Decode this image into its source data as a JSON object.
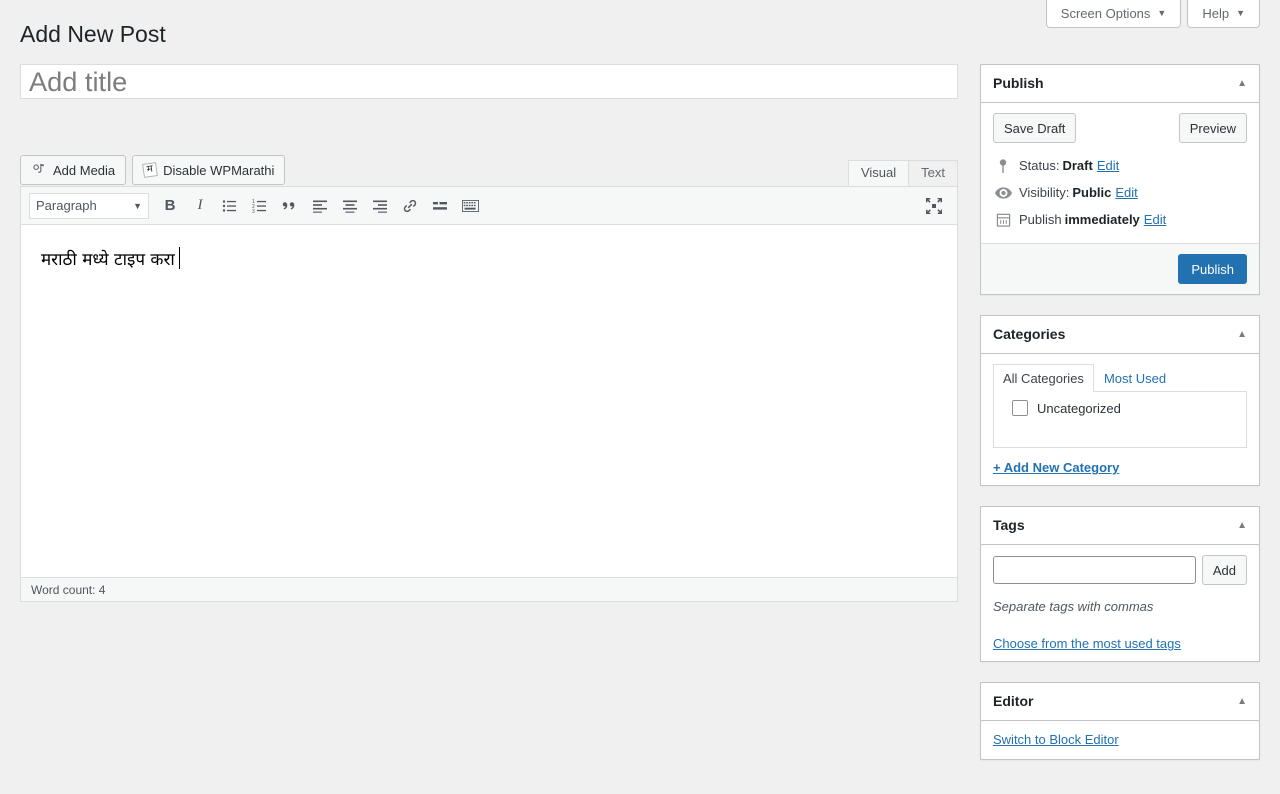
{
  "screen_meta": {
    "screen_options_label": "Screen Options",
    "help_label": "Help",
    "caret": "▼"
  },
  "page": {
    "title": "Add New Post"
  },
  "title_field": {
    "value": "",
    "placeholder": "Add title"
  },
  "media_buttons": {
    "add_media_label": "Add Media",
    "disable_wpmarathi_label": "Disable WPMarathi",
    "wpmarathi_glyph": "म"
  },
  "editor_tabs": {
    "visual_label": "Visual",
    "text_label": "Text",
    "active": "Visual"
  },
  "toolbar": {
    "format_label": "Paragraph",
    "format_caret": "▼",
    "buttons": [
      {
        "name": "bold-icon",
        "label": "B"
      },
      {
        "name": "italic-icon",
        "label": "I"
      },
      {
        "name": "bulleted-list-icon",
        "label": ""
      },
      {
        "name": "numbered-list-icon",
        "label": ""
      },
      {
        "name": "blockquote-icon",
        "label": "“"
      },
      {
        "name": "align-left-icon",
        "label": ""
      },
      {
        "name": "align-center-icon",
        "label": ""
      },
      {
        "name": "align-right-icon",
        "label": ""
      },
      {
        "name": "link-icon",
        "label": ""
      },
      {
        "name": "read-more-icon",
        "label": ""
      },
      {
        "name": "toolbar-toggle-icon",
        "label": ""
      }
    ],
    "fullscreen_name": "distraction-free-icon"
  },
  "editor": {
    "content": "मराठी मध्ये टाइप करा",
    "word_count": "Word count: 4"
  },
  "publish_box": {
    "title": "Publish",
    "toggle_arrow": "▲",
    "save_draft_label": "Save Draft",
    "preview_label": "Preview",
    "status_prefix": "Status:",
    "status_value": "Draft",
    "status_edit": "Edit",
    "visibility_prefix": "Visibility:",
    "visibility_value": "Public",
    "visibility_edit": "Edit",
    "publish_prefix": "Publish",
    "publish_value": "immediately",
    "publish_edit": "Edit",
    "publish_button_label": "Publish"
  },
  "categories_box": {
    "title": "Categories",
    "toggle_arrow": "▲",
    "tab_all_label": "All Categories",
    "tab_most_used_label": "Most Used",
    "active_tab": "All Categories",
    "items": [
      {
        "label": "Uncategorized",
        "checked": false
      }
    ],
    "add_new_label": "+ Add New Category"
  },
  "tags_box": {
    "title": "Tags",
    "toggle_arrow": "▲",
    "input_value": "",
    "input_placeholder": "",
    "add_label": "Add",
    "hint": "Separate tags with commas",
    "most_used_link": "Choose from the most used tags"
  },
  "editor_box": {
    "title": "Editor",
    "toggle_arrow": "▲",
    "switch_link": "Switch to Block Editor"
  },
  "colors": {
    "accent": "#2271b1",
    "background": "#f0f0f1",
    "border": "#c3c4c7",
    "text": "#3c434a"
  }
}
